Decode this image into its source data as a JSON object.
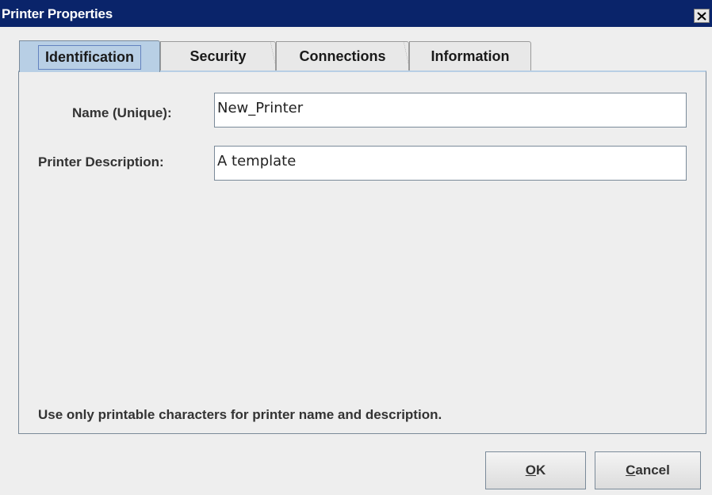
{
  "window": {
    "title": "Printer Properties",
    "close_icon": "close-icon"
  },
  "tabs": [
    {
      "label": "Identification",
      "selected": true
    },
    {
      "label": "Security",
      "selected": false
    },
    {
      "label": "Connections",
      "selected": false
    },
    {
      "label": "Information",
      "selected": false
    }
  ],
  "form": {
    "name_label": "Name (Unique):",
    "name_value": "New_Printer",
    "description_label": "Printer Description:",
    "description_value": "A template",
    "hint": "Use only printable characters for printer name and description."
  },
  "buttons": {
    "ok_mnemonic": "O",
    "ok_rest": "K",
    "cancel_mnemonic": "C",
    "cancel_rest": "ancel"
  },
  "colors": {
    "titlebar": "#0a246a",
    "selected_tab": "#b8cfe5",
    "background": "#eeeeee"
  }
}
